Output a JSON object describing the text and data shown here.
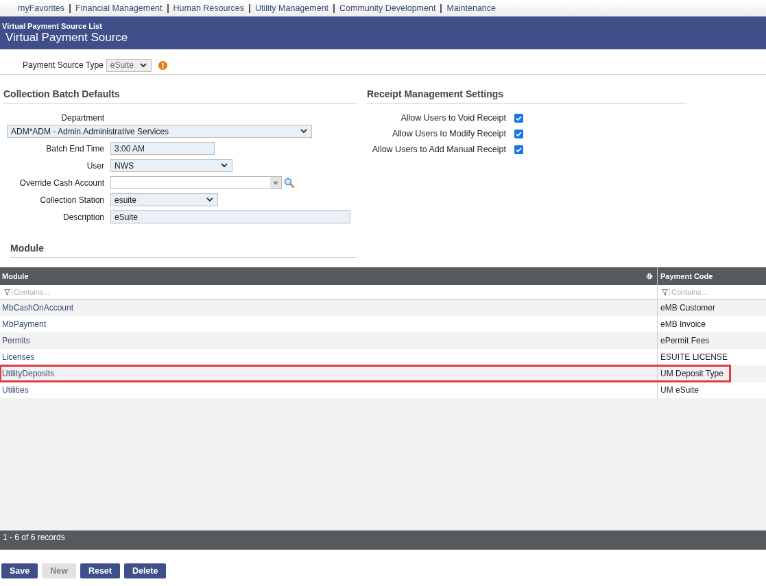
{
  "nav": [
    "myFavorites",
    "Financial Management",
    "Human Resources",
    "Utility Management",
    "Community Development",
    "Maintenance"
  ],
  "header": {
    "breadcrumb": "Virtual Payment Source List",
    "title": "Virtual Payment Source"
  },
  "payment_source_type": {
    "label": "Payment Source Type",
    "value": "eSuite",
    "disabled": true
  },
  "collection_batch": {
    "heading": "Collection Batch Defaults",
    "fields": [
      {
        "kind": "wide-select",
        "label": "Department",
        "value": "ADM*ADM - Admin.Administrative Services"
      },
      {
        "kind": "text",
        "label": "Batch End Time",
        "value": "3:00 AM"
      },
      {
        "kind": "select",
        "label": "User",
        "value": "NWS"
      },
      {
        "kind": "lookup",
        "label": "Override Cash Account"
      },
      {
        "kind": "select",
        "label": "Collection Station",
        "value": "esuite"
      },
      {
        "kind": "long-text",
        "label": "Description",
        "value": "eSuite"
      }
    ]
  },
  "receipt_settings": {
    "heading": "Receipt Management Settings",
    "options": [
      {
        "label": "Allow Users to Void Receipt",
        "checked": true
      },
      {
        "label": "Allow Users to Modify Receipt",
        "checked": true
      },
      {
        "label": "Allow Users to Add Manual Receipt",
        "checked": true
      }
    ]
  },
  "module_section": {
    "heading": "Module"
  },
  "table": {
    "columns": [
      {
        "title": "Module",
        "placeholder": "Contains..."
      },
      {
        "title": "Payment Code",
        "placeholder": "Contains..."
      }
    ],
    "rows": [
      {
        "module": "MbCashOnAccount",
        "payment_code": "eMB Customer",
        "highlighted": false
      },
      {
        "module": "MbPayment",
        "payment_code": "eMB Invoice",
        "highlighted": false
      },
      {
        "module": "Permits",
        "payment_code": "ePermit Fees",
        "highlighted": false
      },
      {
        "module": "Licenses",
        "payment_code": "ESUITE LICENSE",
        "highlighted": false
      },
      {
        "module": "UtilityDeposits",
        "payment_code": "UM Deposit Type",
        "highlighted": true
      },
      {
        "module": "Utilities",
        "payment_code": "UM eSuite",
        "highlighted": false
      }
    ],
    "footer": "1 - 6 of 6 records"
  },
  "buttons": [
    {
      "label": "Save",
      "disabled": false
    },
    {
      "label": "New",
      "disabled": true
    },
    {
      "label": "Reset",
      "disabled": false
    },
    {
      "label": "Delete",
      "disabled": false
    }
  ]
}
